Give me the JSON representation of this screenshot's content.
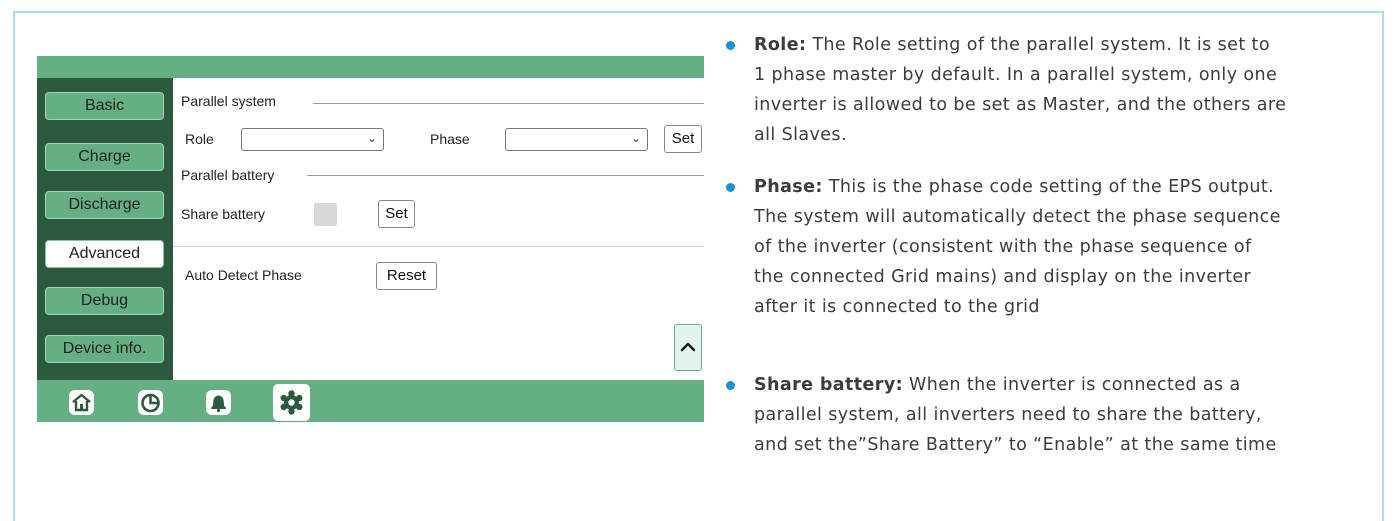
{
  "sidebar": {
    "items": [
      {
        "label": "Basic",
        "active": false
      },
      {
        "label": "Charge",
        "active": false
      },
      {
        "label": "Discharge",
        "active": false
      },
      {
        "label": "Advanced",
        "active": true
      },
      {
        "label": "Debug",
        "active": false
      },
      {
        "label": "Device info.",
        "active": false
      }
    ]
  },
  "panel": {
    "parallel_system_title": "Parallel system",
    "role_label": "Role",
    "role_value": "",
    "phase_label": "Phase",
    "phase_value": "",
    "set_label": "Set",
    "parallel_battery_title": "Parallel battery",
    "share_battery_label": "Share battery",
    "share_battery_checked": false,
    "share_set_label": "Set",
    "auto_detect_label": "Auto Detect Phase",
    "reset_label": "Reset"
  },
  "bottom_tabs": [
    {
      "icon": "home-icon",
      "active": false
    },
    {
      "icon": "pie-chart-icon",
      "active": false
    },
    {
      "icon": "bell-icon",
      "active": false
    },
    {
      "icon": "gear-icon",
      "active": true
    }
  ],
  "colors": {
    "bar_green": "#65b083",
    "sidebar_dark": "#2d5a3f",
    "bullet_blue": "#1d8fd6",
    "frame_blue": "#a9dcef"
  },
  "description": {
    "role": {
      "term": "Role:",
      "line1": " The Role setting of the parallel system. It is set to",
      "line2": "1 phase master by default. In a parallel system, only one",
      "line3": "inverter is allowed to be set as Master, and the others are",
      "line4": "all Slaves."
    },
    "phase": {
      "term": "Phase:",
      "line1": " This is the phase code setting of the EPS output.",
      "line2": "The system will automatically detect the phase sequence",
      "line3": "of the inverter (consistent with the phase sequence of",
      "line4": "the connected Grid mains) and display on the inverter",
      "line5": "after it is connected to the grid"
    },
    "share": {
      "term": "Share battery:",
      "line1": " When the inverter is connected as a",
      "line2": "parallel system, all inverters need to share the battery,",
      "line3": "and set the”Share Battery” to “Enable” at the same time"
    }
  }
}
